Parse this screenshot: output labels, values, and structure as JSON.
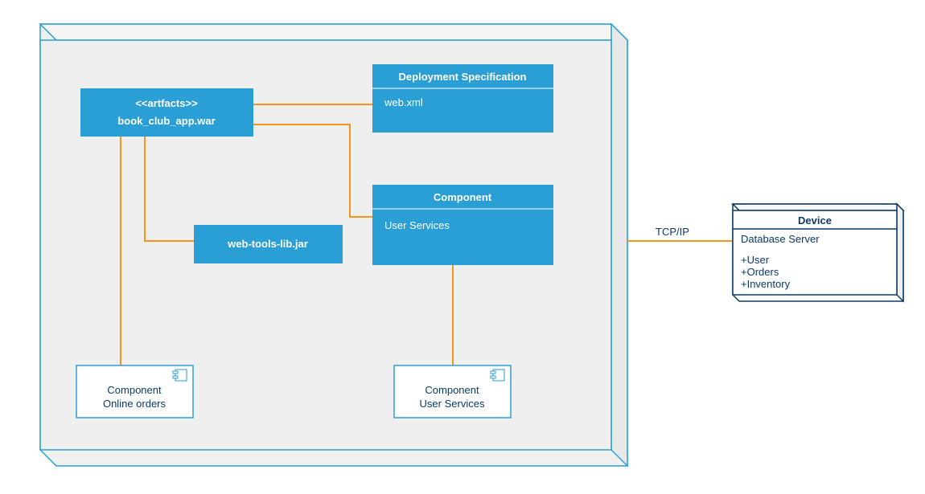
{
  "artifact": {
    "stereotype": "<<artfacts>>",
    "name": "book_club_app.war"
  },
  "deployment_spec": {
    "title": "Deployment Specification",
    "content": "web.xml"
  },
  "component_main": {
    "title": "Component",
    "content": "User Services"
  },
  "lib": {
    "name": "web-tools-lib.jar"
  },
  "component_a": {
    "title": "Component",
    "content": "Online orders"
  },
  "component_b": {
    "title": "Component",
    "content": "User Services"
  },
  "connection_label": "TCP/IP",
  "device": {
    "title": "Device",
    "name": "Database Server",
    "attr1": "+User",
    "attr2": "+Orders",
    "attr3": "+Inventory"
  }
}
